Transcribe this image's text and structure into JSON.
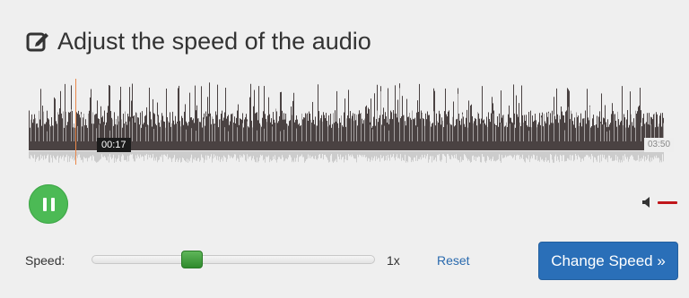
{
  "header": {
    "title": "Adjust the speed of the audio",
    "icon": "edit-icon"
  },
  "player": {
    "current_time": "00:17",
    "total_time": "03:50",
    "progress_fraction": 0.074,
    "state": "playing",
    "play_pause_icon": "pause-icon",
    "volume_icon": "speaker-icon",
    "waveform_color": "#4a4242",
    "played_color": "#e9874a",
    "reflection_color": "#bdbdbd"
  },
  "speed": {
    "label": "Speed:",
    "value": "1x",
    "slider_fraction": 0.34,
    "reset_label": "Reset",
    "button_label": "Change Speed »"
  },
  "colors": {
    "background": "#efefef",
    "play_button": "#4cba55",
    "slider_thumb": "#3f9c3b",
    "primary_button": "#2a6fb8",
    "link": "#2a6aae",
    "volume_level": "#c0161b"
  }
}
